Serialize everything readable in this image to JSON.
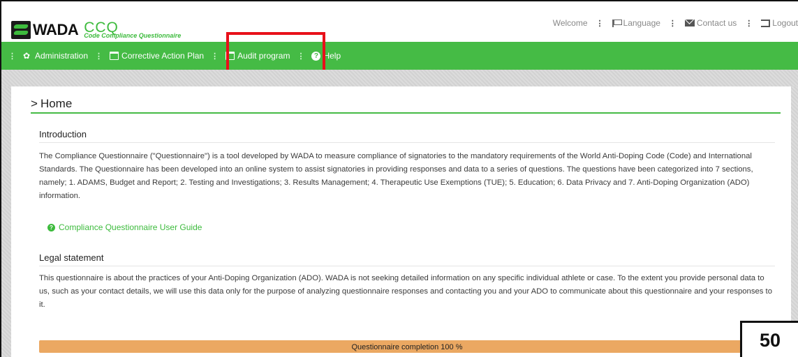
{
  "header": {
    "logo_wada": "WADA",
    "logo_ccq": "CCQ",
    "logo_sub": "Code Compliance Questionnaire",
    "top_links": {
      "welcome": "Welcome",
      "language": "Language",
      "contact": "Contact us",
      "logout": "Logout"
    }
  },
  "nav": {
    "items": [
      {
        "label": "Administration",
        "icon": "gear-icon"
      },
      {
        "label": "Corrective Action Plan",
        "icon": "calendar-icon"
      },
      {
        "label": "Audit program",
        "icon": "calendar-icon"
      },
      {
        "label": "Help",
        "icon": "question-circle-icon"
      }
    ]
  },
  "main": {
    "page_title": "Home",
    "intro_heading": "Introduction",
    "intro_text": "The Compliance Questionnaire (\"Questionnaire\") is a tool developed by WADA to measure compliance of signatories to the mandatory requirements of the World Anti-Doping Code (Code) and International Standards. The Questionnaire has been developed into an online system to assist signatories in providing responses and data to a series of questions. The questions have been categorized into 7 sections, namely; 1. ADAMS, Budget and Report; 2. Testing and Investigations; 3. Results Management; 4. Therapeutic Use Exemptions (TUE); 5. Education; 6. Data Privacy and 7. Anti-Doping Organization (ADO) information.",
    "guide_link": "Compliance Questionnaire User Guide",
    "legal_heading": "Legal statement",
    "legal_text": "This questionnaire is about the practices of your Anti-Doping Organization (ADO). WADA is not seeking detailed information on any specific individual athlete or case. To the extent you provide personal data to us, such as your contact details, we will use this data only for the purpose of analyzing questionnaire responses and contacting you and your ADO to communicate about this questionnaire and your responses to it.",
    "progress": {
      "label": "Questionnaire completion 100 %",
      "value_percent": 100
    }
  },
  "badge": "50",
  "colors": {
    "nav_green": "#45bb45",
    "brand_green": "#3dbb3d",
    "progress_orange": "#eba862",
    "highlight_red": "#e8101a"
  }
}
